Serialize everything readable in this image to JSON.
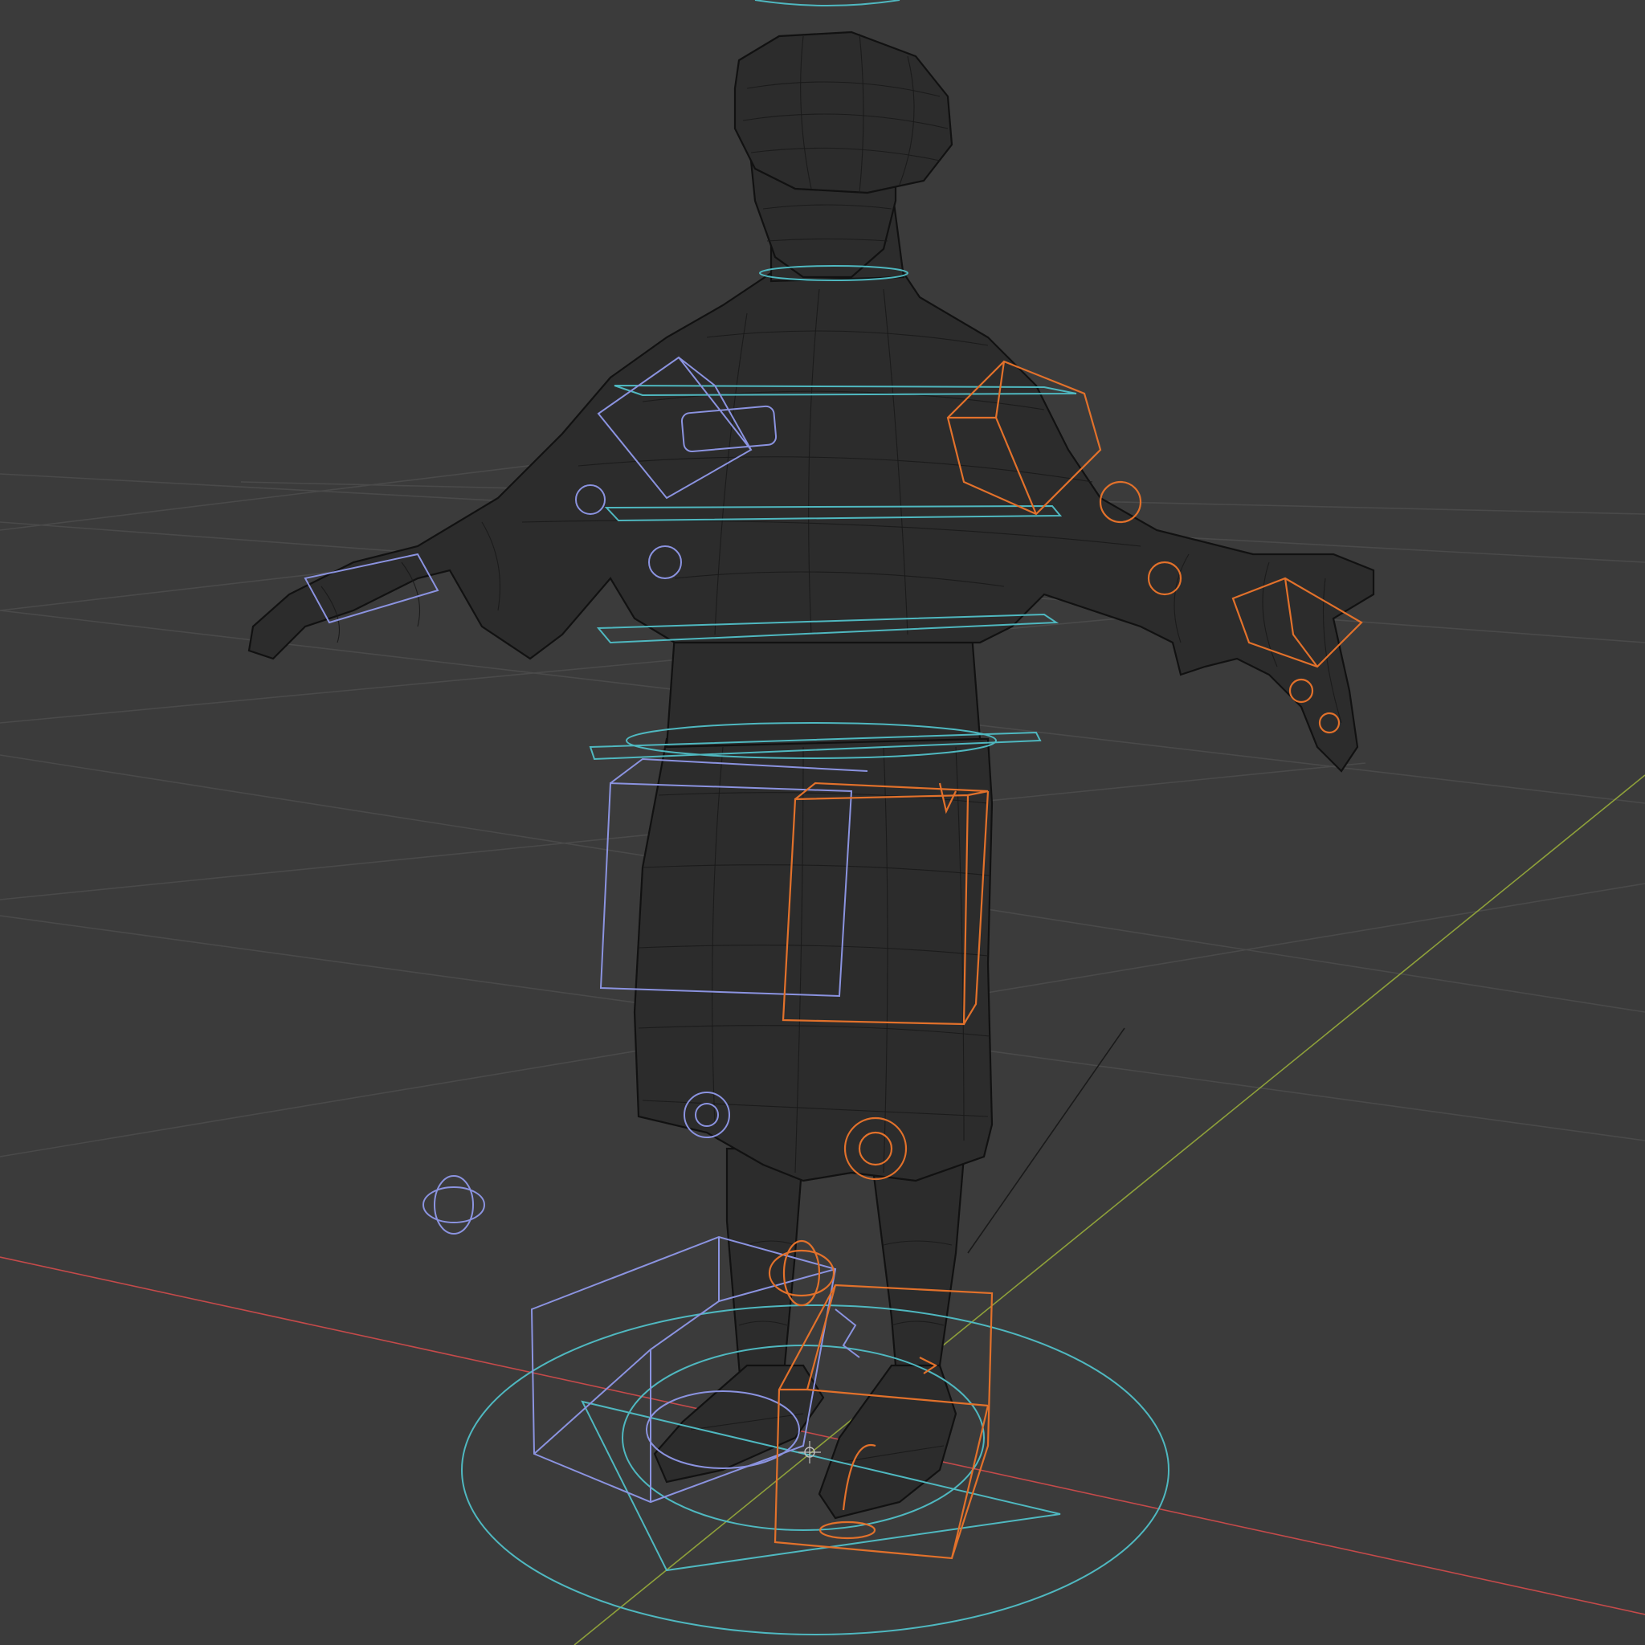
{
  "viewport": {
    "mode": "wireframe",
    "background": "#3b3b3b"
  },
  "colors": {
    "grid": "#4a4a4a",
    "axis_x": "#c44a4a",
    "axis_y": "#8ea03a",
    "mesh": "#111111",
    "rig_control_cyan": "#4fb8c0",
    "rig_control_left": "#8b93e0",
    "rig_control_right": "#e2712b"
  },
  "scene": {
    "object": "character-mesh-wireframe",
    "rig": "armature-controls",
    "pose": "A-pose"
  }
}
